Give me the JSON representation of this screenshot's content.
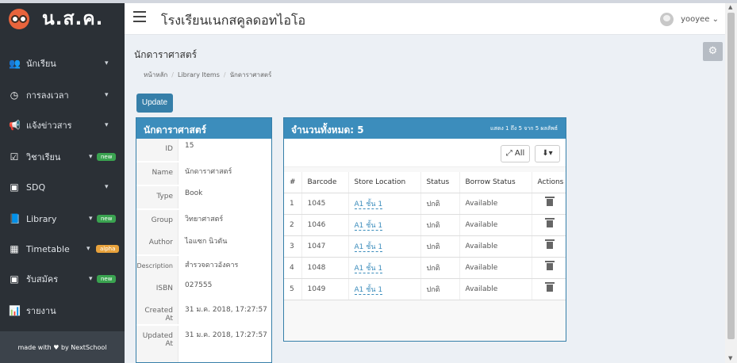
{
  "app": {
    "logo_text": "น.ส.ค.",
    "title": "โรงเรียนเนกสคูลดอทไอโอ"
  },
  "user": {
    "name": "yooyee ⌄"
  },
  "sidebar": {
    "items": [
      {
        "label": "นักเรียน",
        "icon": "users-icon",
        "glyph": "👥"
      },
      {
        "label": "การลงเวลา",
        "icon": "clock-icon",
        "glyph": "◷"
      },
      {
        "label": "แจ้งข่าวสาร",
        "icon": "megaphone-icon",
        "glyph": "📢"
      },
      {
        "label": "วิชาเรียน",
        "icon": "calendar-icon",
        "glyph": "☑",
        "badge": "new"
      },
      {
        "label": "SDQ",
        "icon": "report-icon",
        "glyph": "▣"
      },
      {
        "label": "Library",
        "icon": "book-icon",
        "glyph": "📘",
        "badge": "new"
      },
      {
        "label": "Timetable",
        "icon": "server-icon",
        "glyph": "▦",
        "badge": "alpha"
      },
      {
        "label": "รับสมัคร",
        "icon": "id-card-icon",
        "glyph": "▣",
        "badge": "new"
      },
      {
        "label": "รายงาน",
        "icon": "bar-chart-icon",
        "glyph": "📊"
      }
    ],
    "footer": "made with ♥ by NextSchool"
  },
  "page": {
    "title": "นักดาราศาสตร์",
    "breadcrumb": [
      "หน้าหลัก",
      "Library Items",
      "นักดาราศาสตร์"
    ],
    "update_label": "Update"
  },
  "details": {
    "heading": "นักดาราศาสตร์",
    "rows": [
      {
        "label": "ID",
        "value": "15"
      },
      {
        "label": "Name",
        "value": "นักดาราศาสตร์"
      },
      {
        "label": "Type",
        "value": "Book"
      },
      {
        "label": "Group",
        "value": "วิทยาศาสตร์"
      },
      {
        "label": "Author",
        "value": "ไอแซก นิวตัน"
      },
      {
        "label": "Description",
        "value": "สำรวจดาวอังคาร"
      },
      {
        "label": "ISBN",
        "value": "027555"
      },
      {
        "label": "Created At",
        "value": "31 ม.ค. 2018, 17:27:57"
      },
      {
        "label": "Updated At",
        "value": "31 ม.ค. 2018, 17:27:57"
      }
    ]
  },
  "items": {
    "heading": "จำนวนทั้งหมด: 5",
    "summary": "แสดง 1 ถึง 5 จาก 5 ผลลัพธ์",
    "all_label": "All",
    "columns": [
      "#",
      "Barcode",
      "Store Location",
      "Status",
      "Borrow Status",
      "Actions"
    ],
    "rows": [
      {
        "n": "1",
        "barcode": "1045",
        "location": "A1 ชั้น 1",
        "status": "ปกติ",
        "borrow": "Available"
      },
      {
        "n": "2",
        "barcode": "1046",
        "location": "A1 ชั้น 1",
        "status": "ปกติ",
        "borrow": "Available"
      },
      {
        "n": "3",
        "barcode": "1047",
        "location": "A1 ชั้น 1",
        "status": "ปกติ",
        "borrow": "Available"
      },
      {
        "n": "4",
        "barcode": "1048",
        "location": "A1 ชั้น 1",
        "status": "ปกติ",
        "borrow": "Available"
      },
      {
        "n": "5",
        "barcode": "1049",
        "location": "A1 ชั้น 1",
        "status": "ปกติ",
        "borrow": "Available"
      }
    ]
  },
  "colors": {
    "sidebar_bg": "#2b3036",
    "primary": "#3c8dbc",
    "badge_new": "#3aa350",
    "badge_alpha": "#e8a23c"
  }
}
